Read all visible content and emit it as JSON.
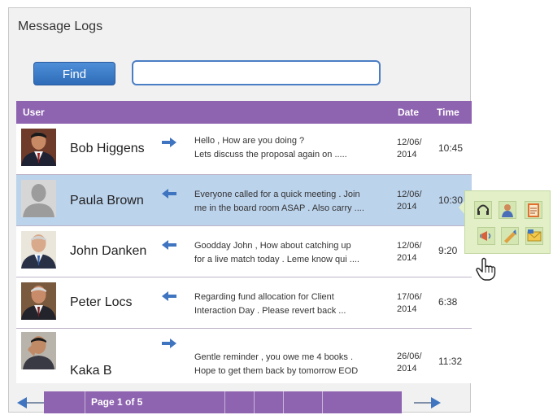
{
  "window": {
    "title": "Message Logs"
  },
  "search": {
    "button_label": "Find",
    "value": "",
    "placeholder": ""
  },
  "table": {
    "headers": {
      "user": "User",
      "date": "Date",
      "time": "Time"
    },
    "rows": [
      {
        "name": "Bob Higgens",
        "direction": "outgoing",
        "message_line1": "Hello , How are you doing ?",
        "message_line2": "Lets discuss the proposal again on  .....",
        "date_line1": "12/06/",
        "date_line2": "2014",
        "time": "10:45",
        "selected": false
      },
      {
        "name": "Paula Brown",
        "direction": "incoming",
        "message_line1": "Everyone called for a quick meeting . Join",
        "message_line2": "me in the board room ASAP . Also carry ....",
        "date_line1": "12/06/",
        "date_line2": "2014",
        "time": "10:30",
        "selected": true
      },
      {
        "name": "John Danken",
        "direction": "incoming",
        "message_line1": "Goodday John ,  How about catching up",
        "message_line2": "for a live match today . Leme know qui ....",
        "date_line1": "12/06/",
        "date_line2": "2014",
        "time": "9:20",
        "selected": false
      },
      {
        "name": "Peter Locs",
        "direction": "incoming",
        "message_line1": "Regarding fund allocation for Client",
        "message_line2": "Interaction Day . Please revert back ...",
        "date_line1": "17/06/",
        "date_line2": "2014",
        "time": "6:38",
        "selected": false
      },
      {
        "name": "Kaka  B",
        "direction": "outgoing",
        "message_line1": "Gentle reminder , you owe me 4 books .",
        "message_line2": "Hope to get them back by tomorrow EOD",
        "date_line1": "26/06/",
        "date_line2": "2014",
        "time": "11:32",
        "selected": false
      }
    ]
  },
  "pagination": {
    "label": "Page 1 of 5",
    "current_page": 1,
    "total_pages": 5
  },
  "context_actions": {
    "icons": [
      "headset-icon",
      "contact-icon",
      "notes-icon",
      "broadcast-icon",
      "forward-icon",
      "email-icon"
    ]
  },
  "colors": {
    "header_purple": "#8e63b0",
    "selected_row": "#bcd3ec",
    "find_button_blue": "#2e6bb8",
    "arrow_blue": "#3f74c0",
    "popup_green": "#e2efc7"
  }
}
